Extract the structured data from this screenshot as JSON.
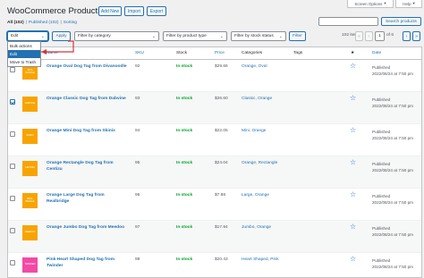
{
  "top_tabs": {
    "screen_options": "Screen Options",
    "help": "Help"
  },
  "header": {
    "title": "WooCommerce Products",
    "add_new": "Add New",
    "import": "Import",
    "export": "Export"
  },
  "views": {
    "all": "All (102)",
    "sep1": "|",
    "published": "Published (102)",
    "sep2": "|",
    "sorting": "Sorting"
  },
  "search": {
    "value": "",
    "button": "Search products"
  },
  "toolbar": {
    "bulk_selected": "Edit",
    "apply": "Apply",
    "category_filter": "Filter by category",
    "type_filter": "Filter by product type",
    "stock_filter": "Filter by stock status",
    "filter_button": "Filter",
    "bulk_options": [
      "Bulk actions",
      "Edit",
      "Move to Trash"
    ]
  },
  "pagination": {
    "items": "102 items",
    "first": "«",
    "prev": "‹",
    "current": "1",
    "of_total": "of 6",
    "next": "›",
    "last": "»"
  },
  "columns": {
    "name": "Name",
    "sku": "SKU",
    "stock": "Stock",
    "price": "Price",
    "categories": "Categories",
    "tags": "Tags",
    "featured": "★",
    "date": "Date"
  },
  "rows": [
    {
      "name": "Orange Oval Dog Tag from Divanoodle",
      "sku": "92",
      "stock": "In stock",
      "price": "$29.66",
      "categories": "Orange, Oval",
      "status": "Published",
      "date": "2022/08/24 at 7:50 pm",
      "thumb_color": "#f7a400",
      "thumb_text": "DIVA NOODLE",
      "checked": "no"
    },
    {
      "name": "Orange Classic Dog Tag from Dabvine",
      "sku": "93",
      "stock": "In stock",
      "price": "$26.60",
      "categories": "Classic, Orange",
      "status": "Published",
      "date": "2022/08/24 at 7:50 pm",
      "thumb_color": "#f7a400",
      "thumb_text": "DABVINE",
      "checked": "yes"
    },
    {
      "name": "Orange Mini Dog Tag from Skinix",
      "sku": "94",
      "stock": "In stock",
      "price": "$22.05",
      "categories": "Mini, Orange",
      "status": "Published",
      "date": "2022/08/24 at 7:50 pm",
      "thumb_color": "#f7a400",
      "thumb_text": "SKINIX",
      "checked": "no"
    },
    {
      "name": "Orange Rectangle Dog Tag from Centizu",
      "sku": "95",
      "stock": "In stock",
      "price": "$24.04",
      "categories": "Orange, Rectangle",
      "status": "Published",
      "date": "2022/08/24 at 7:50 pm",
      "thumb_color": "#f7a400",
      "thumb_text": "CENTIZU",
      "checked": "no"
    },
    {
      "name": "Orange Large Dog Tag from Realbridge",
      "sku": "96",
      "stock": "In stock",
      "price": "$7.88",
      "categories": "Large, Orange",
      "status": "Published",
      "date": "2022/08/24 at 7:50 pm",
      "thumb_color": "#f7a400",
      "thumb_text": "REAL BRIDGE",
      "checked": "no"
    },
    {
      "name": "Orange Jumbo Dog Tag from Meedoo",
      "sku": "97",
      "stock": "In stock",
      "price": "$17.94",
      "categories": "Jumbo, Orange",
      "status": "Published",
      "date": "2022/08/24 at 7:50 pm",
      "thumb_color": "#f7a400",
      "thumb_text": "MEEDOO",
      "checked": "no"
    },
    {
      "name": "Pink Heart Shaped Dog Tag from Twinder",
      "sku": "98",
      "stock": "In stock",
      "price": "$20.43",
      "categories": "Heart Shaped, Pink",
      "status": "Published",
      "date": "2022/08/24 at 7:50 pm",
      "thumb_color": "#f24aa6",
      "thumb_text": "TWINDER",
      "checked": "no"
    }
  ]
}
